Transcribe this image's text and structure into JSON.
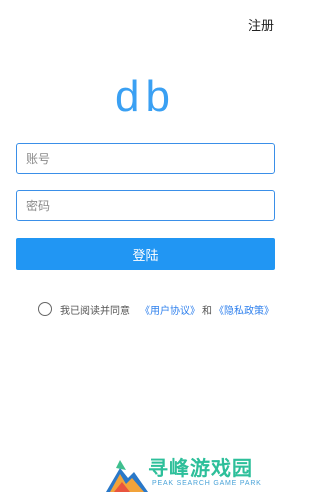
{
  "header": {
    "register_label": "注册"
  },
  "logo": {
    "text": "db"
  },
  "form": {
    "account_placeholder": "账号",
    "password_placeholder": "密码",
    "login_label": "登陆"
  },
  "agreement": {
    "prefix": "我已阅读并同意",
    "user_agreement": "《用户协议》",
    "and": "和",
    "privacy_policy": "《隐私政策》",
    "checked": false
  },
  "watermark": {
    "cn": "寻峰游戏园",
    "en": "PEAK SEARCH GAME PARK"
  }
}
